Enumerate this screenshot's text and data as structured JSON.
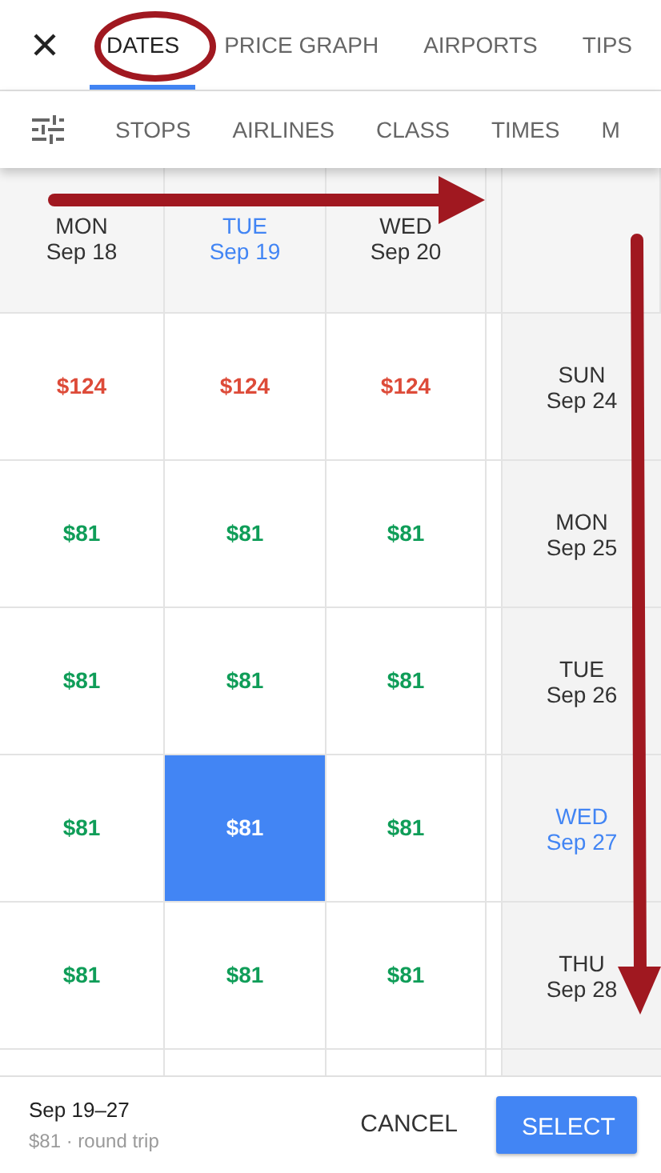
{
  "tabs": [
    {
      "label": "DATES",
      "selected": true
    },
    {
      "label": "PRICE GRAPH",
      "selected": false
    },
    {
      "label": "AIRPORTS",
      "selected": false
    },
    {
      "label": "TIPS",
      "selected": false
    }
  ],
  "filters": [
    "STOPS",
    "AIRLINES",
    "CLASS",
    "TIMES",
    "M"
  ],
  "columns": [
    {
      "day": "MON",
      "date": "Sep 18",
      "selected": false
    },
    {
      "day": "TUE",
      "date": "Sep 19",
      "selected": true
    },
    {
      "day": "WED",
      "date": "Sep 20",
      "selected": false
    }
  ],
  "rows": [
    {
      "day": "SUN",
      "date": "Sep 24",
      "selected": false,
      "cells": [
        {
          "price": "$124",
          "color": "#dd4b39",
          "selected": false
        },
        {
          "price": "$124",
          "color": "#dd4b39",
          "selected": false
        },
        {
          "price": "$124",
          "color": "#dd4b39",
          "selected": false
        }
      ]
    },
    {
      "day": "MON",
      "date": "Sep 25",
      "selected": false,
      "cells": [
        {
          "price": "$81",
          "color": "#0f9d58",
          "selected": false
        },
        {
          "price": "$81",
          "color": "#0f9d58",
          "selected": false
        },
        {
          "price": "$81",
          "color": "#0f9d58",
          "selected": false
        }
      ]
    },
    {
      "day": "TUE",
      "date": "Sep 26",
      "selected": false,
      "cells": [
        {
          "price": "$81",
          "color": "#0f9d58",
          "selected": false
        },
        {
          "price": "$81",
          "color": "#0f9d58",
          "selected": false
        },
        {
          "price": "$81",
          "color": "#0f9d58",
          "selected": false
        }
      ]
    },
    {
      "day": "WED",
      "date": "Sep 27",
      "selected": true,
      "cells": [
        {
          "price": "$81",
          "color": "#0f9d58",
          "selected": false
        },
        {
          "price": "$81",
          "selected": true
        },
        {
          "price": "$81",
          "color": "#0f9d58",
          "selected": false
        }
      ]
    },
    {
      "day": "THU",
      "date": "Sep 28",
      "selected": false,
      "cells": [
        {
          "price": "$81",
          "color": "#0f9d58",
          "selected": false
        },
        {
          "price": "$81",
          "color": "#0f9d58",
          "selected": false
        },
        {
          "price": "$81",
          "color": "#0f9d58",
          "selected": false
        }
      ]
    }
  ],
  "footer": {
    "dates": "Sep 19–27",
    "summary": "$81 · round trip",
    "cancel": "CANCEL",
    "select": "SELECT"
  }
}
